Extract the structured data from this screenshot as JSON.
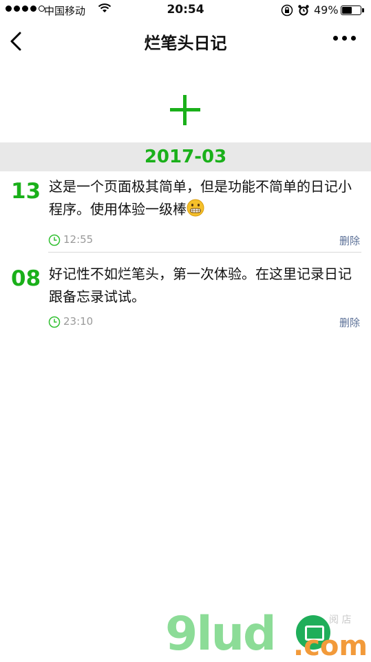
{
  "status_bar": {
    "carrier": "中国移动",
    "time": "20:54",
    "battery": "49%",
    "battery_level": 0.49
  },
  "nav": {
    "title": "烂笔头日记"
  },
  "month_header": "2017-03",
  "entries": [
    {
      "day": "13",
      "text": "这是一个页面极其简单，但是功能不简单的日记小程序。使用体验一级棒",
      "emoji": "grimacing-face-icon",
      "time": "12:55",
      "delete_label": "删除"
    },
    {
      "day": "08",
      "text": "好记性不如烂笔头，第一次体验。在这里记录日记跟备忘录试试。",
      "time": "23:10",
      "delete_label": "删除"
    }
  ],
  "colors": {
    "accent": "#1ab01a",
    "month_bar_bg": "#e8e8e8",
    "delete_link": "#5a6f96"
  },
  "watermark": {
    "brand": "9lud",
    "tld": ".com",
    "tagline": "阅 店"
  }
}
